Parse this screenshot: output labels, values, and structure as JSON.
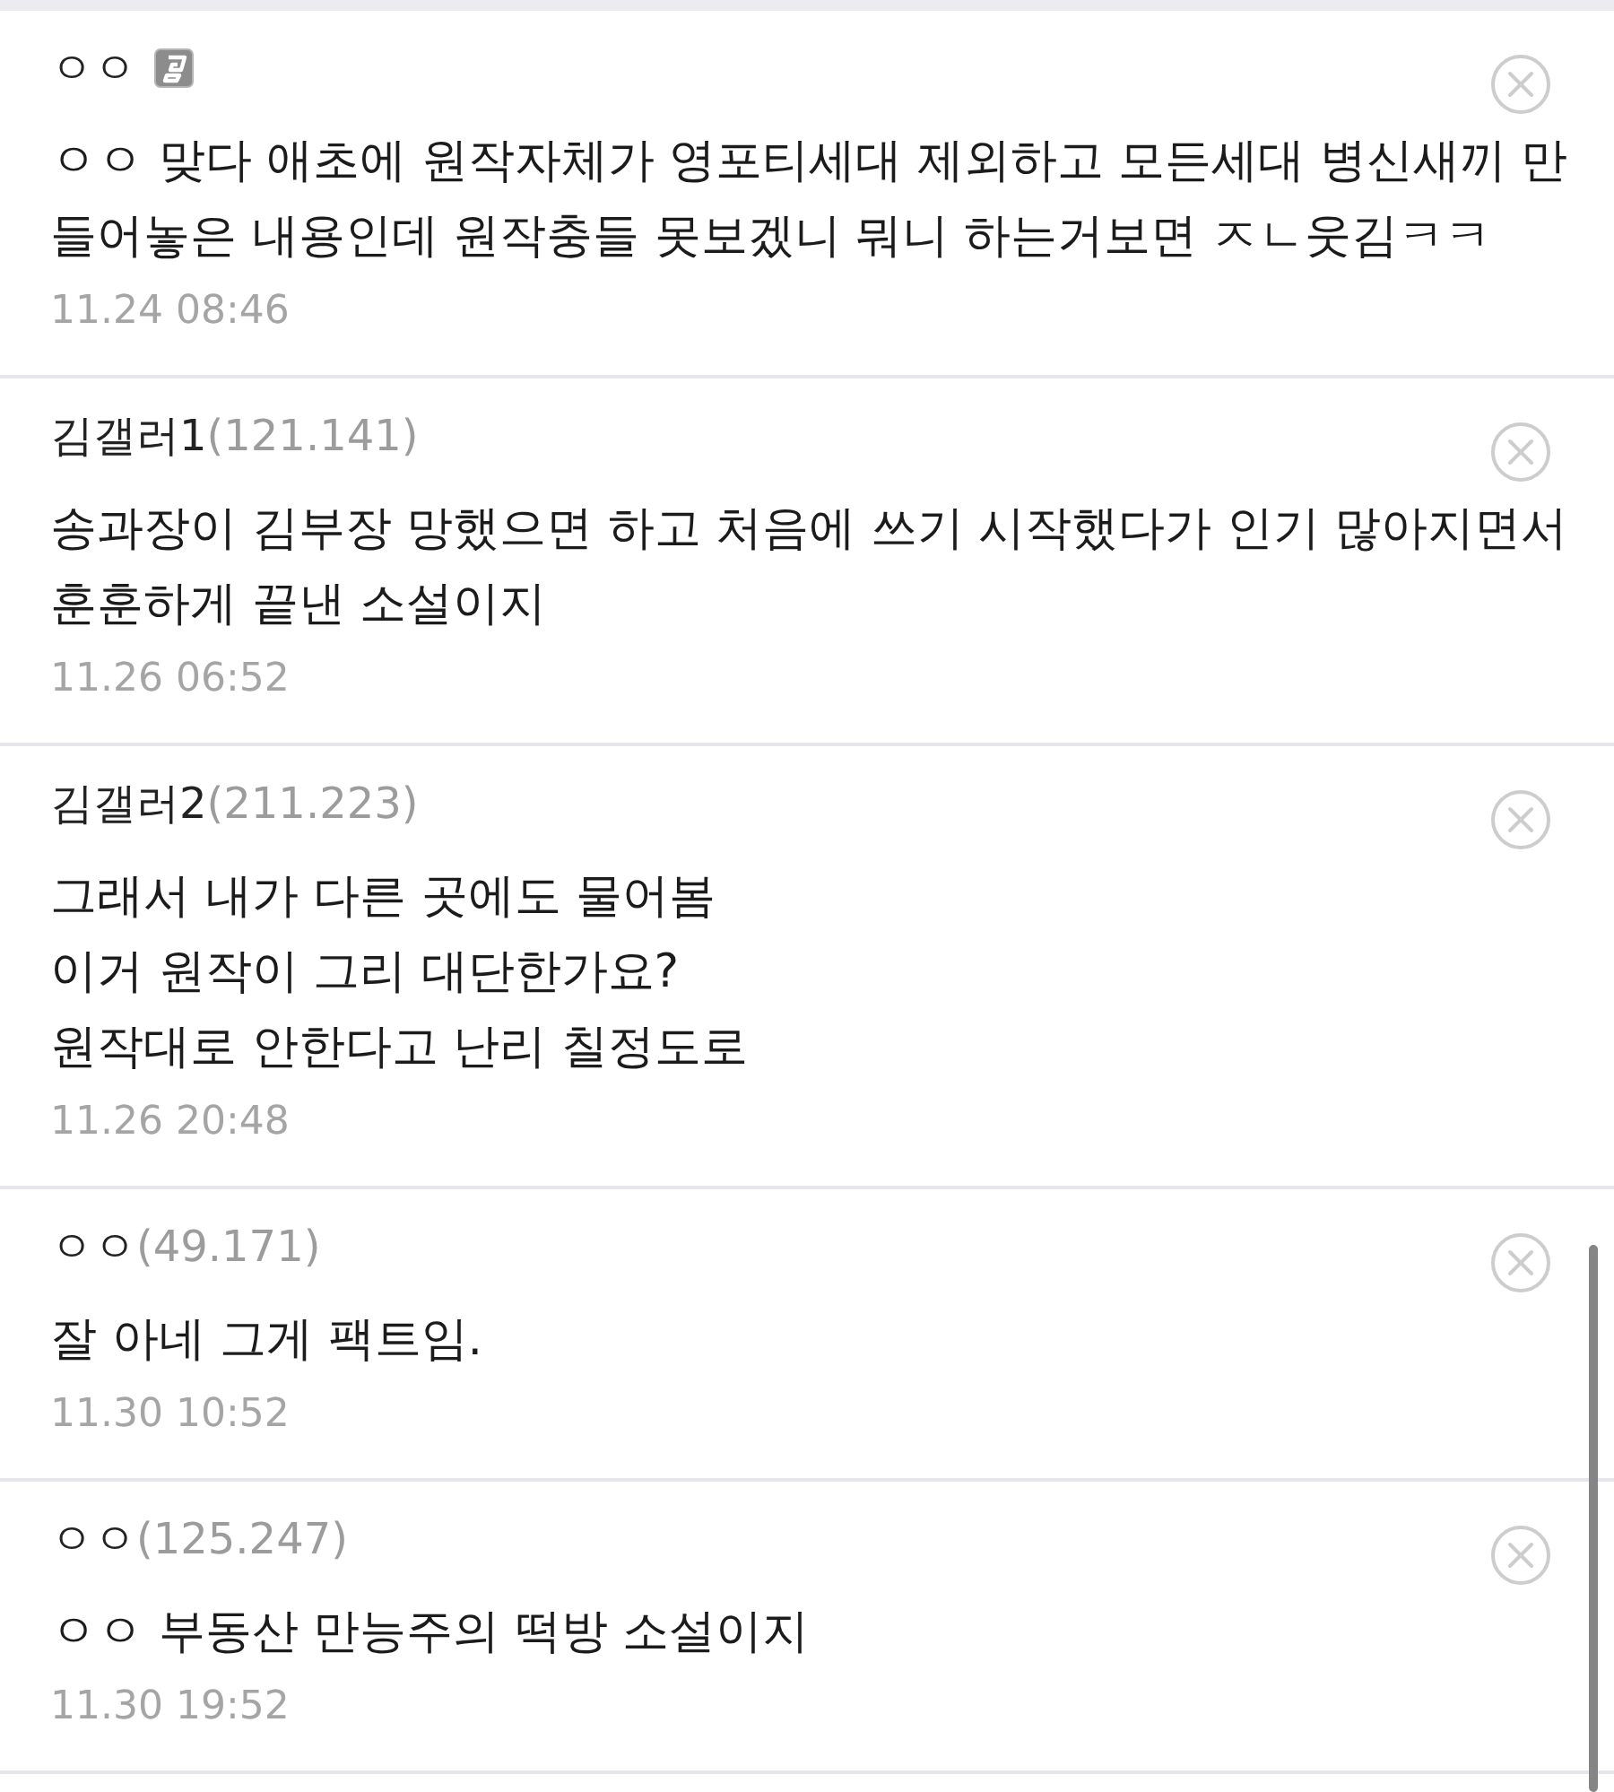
{
  "comments": [
    {
      "author": "ㅇㅇ",
      "kind": "member",
      "body": "ㅇㅇ 맞다 애초에 원작자체가 영포티세대 제외하고 모든세대 병신새끼 만들어놓은 내용인데 원작충들 못보겠니 뭐니 하는거보면 ㅈㄴ웃김ㅋㅋ",
      "time": "11.24 08:46"
    },
    {
      "author": "김갤러1",
      "kind": "guest",
      "ip": "(121.141)",
      "body": "송과장이 김부장 망했으면 하고 처음에 쓰기 시작했다가 인기 많아지면서 훈훈하게 끝낸 소설이지",
      "time": "11.26 06:52"
    },
    {
      "author": "김갤러2",
      "kind": "guest",
      "ip": "(211.223)",
      "body": "그래서 내가 다른 곳에도 물어봄\n이거 원작이 그리 대단한가요?\n원작대로 안한다고 난리 칠정도로",
      "time": "11.26 20:48"
    },
    {
      "author": "ㅇㅇ",
      "kind": "guest",
      "ip": "(49.171)",
      "body": "잘 아네 그게 팩트임.",
      "time": "11.30 10:52"
    },
    {
      "author": "ㅇㅇ",
      "kind": "guest",
      "ip": "(125.247)",
      "body": "ㅇㅇ 부동산 만능주의 떡방 소설이지",
      "time": "11.30 19:52"
    }
  ]
}
